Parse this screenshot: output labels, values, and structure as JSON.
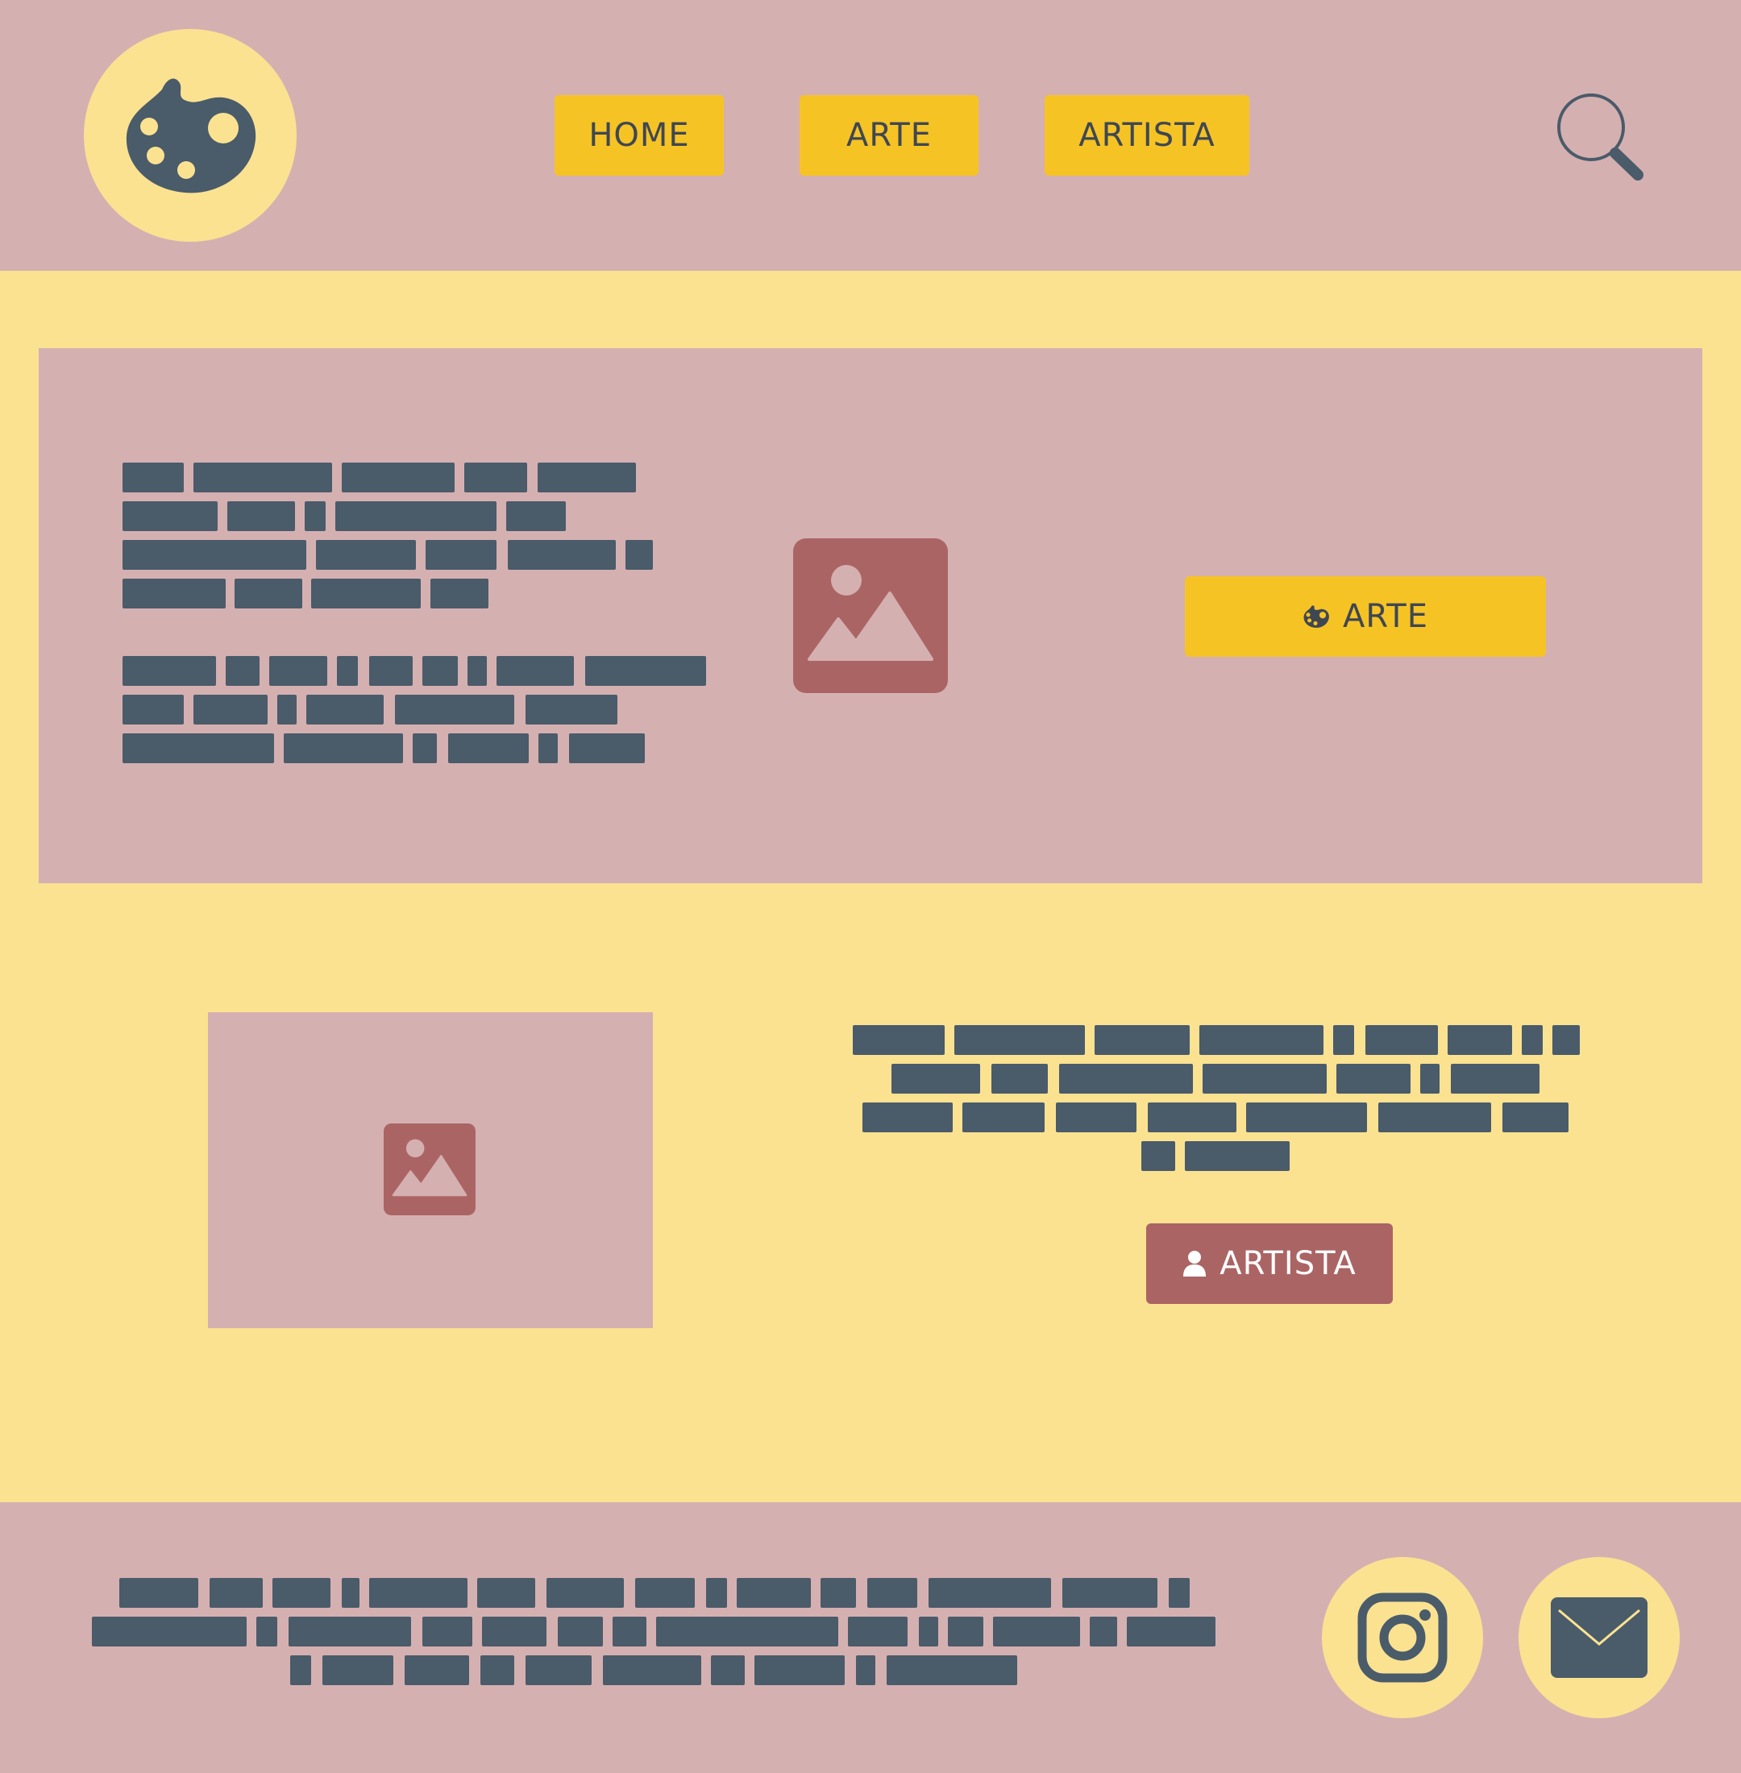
{
  "header": {
    "logo_icon": "palette-icon",
    "nav": [
      {
        "label": "HOME"
      },
      {
        "label": "ARTE"
      },
      {
        "label": "ARTISTA"
      }
    ],
    "search_icon": "search-icon"
  },
  "hero": {
    "image_icon": "image-placeholder-icon",
    "cta": {
      "label": "ARTE",
      "icon": "palette-icon"
    }
  },
  "feature": {
    "image_icon": "image-placeholder-icon",
    "cta": {
      "label": "ARTISTA",
      "icon": "user-icon"
    }
  },
  "footer": {
    "social": [
      {
        "icon": "instagram-icon"
      },
      {
        "icon": "mail-icon"
      }
    ]
  },
  "colors": {
    "page_bg": "#FAE291",
    "panel_bg": "#D5B0B1",
    "accent_yellow": "#F6C325",
    "accent_red": "#AB6464",
    "text_placeholder": "#4A5B6A"
  }
}
